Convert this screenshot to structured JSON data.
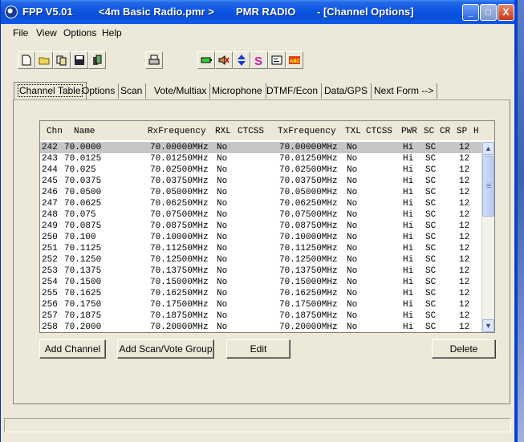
{
  "titlebar": {
    "app": "FPP V5.01",
    "file": "<4m Basic Radio.pmr >",
    "product": "PMR RADIO",
    "view": "- [Channel Options]"
  },
  "menu": [
    "File",
    "View",
    "Options",
    "Help"
  ],
  "toolbar": {
    "icons": [
      "new-file-icon",
      "open-folder-icon",
      "copy-icon",
      "save-icon",
      "radio-device-icon",
      "print-icon",
      "battery-icon",
      "mute-speaker-icon",
      "sort-arrows-icon",
      "s-icon",
      "form-icon",
      "abc-icon"
    ]
  },
  "tabs": [
    "Channel Table",
    "Options",
    "Scan",
    "Vote/Multiax",
    "Microphone",
    "DTMF/Econ",
    "Data/GPS",
    "Next Form -->"
  ],
  "table": {
    "headers": [
      "Chn",
      "Name",
      "RxFrequency",
      "RXL",
      "CTCSS",
      "TxFrequency",
      "TXL",
      "CTCSS",
      "PWR",
      "SC",
      "CR",
      "SP",
      "H"
    ],
    "rows": [
      [
        "242",
        "70.0000",
        "70.00000MHz",
        "No",
        "70.00000MHz",
        "No",
        "Hi",
        "SC",
        "12"
      ],
      [
        "243",
        "70.0125",
        "70.01250MHz",
        "No",
        "70.01250MHz",
        "No",
        "Hi",
        "SC",
        "12"
      ],
      [
        "244",
        "70.025",
        "70.02500MHz",
        "No",
        "70.02500MHz",
        "No",
        "Hi",
        "SC",
        "12"
      ],
      [
        "245",
        "70.0375",
        "70.03750MHz",
        "No",
        "70.03750MHz",
        "No",
        "Hi",
        "SC",
        "12"
      ],
      [
        "246",
        "70.0500",
        "70.05000MHz",
        "No",
        "70.05000MHz",
        "No",
        "Hi",
        "SC",
        "12"
      ],
      [
        "247",
        "70.0625",
        "70.06250MHz",
        "No",
        "70.06250MHz",
        "No",
        "Hi",
        "SC",
        "12"
      ],
      [
        "248",
        "70.075",
        "70.07500MHz",
        "No",
        "70.07500MHz",
        "No",
        "Hi",
        "SC",
        "12"
      ],
      [
        "249",
        "70.0875",
        "70.08750MHz",
        "No",
        "70.08750MHz",
        "No",
        "Hi",
        "SC",
        "12"
      ],
      [
        "250",
        "70.100",
        "70.10000MHz",
        "No",
        "70.10000MHz",
        "No",
        "Hi",
        "SC",
        "12"
      ],
      [
        "251",
        "70.1125",
        "70.11250MHz",
        "No",
        "70.11250MHz",
        "No",
        "Hi",
        "SC",
        "12"
      ],
      [
        "252",
        "70.1250",
        "70.12500MHz",
        "No",
        "70.12500MHz",
        "No",
        "Hi",
        "SC",
        "12"
      ],
      [
        "253",
        "70.1375",
        "70.13750MHz",
        "No",
        "70.13750MHz",
        "No",
        "Hi",
        "SC",
        "12"
      ],
      [
        "254",
        "70.1500",
        "70.15000MHz",
        "No",
        "70.15000MHz",
        "No",
        "Hi",
        "SC",
        "12"
      ],
      [
        "255",
        "70.1625",
        "70.16250MHz",
        "No",
        "70.16250MHz",
        "No",
        "Hi",
        "SC",
        "12"
      ],
      [
        "256",
        "70.1750",
        "70.17500MHz",
        "No",
        "70.17500MHz",
        "No",
        "Hi",
        "SC",
        "12"
      ],
      [
        "257",
        "70.1875",
        "70.18750MHz",
        "No",
        "70.18750MHz",
        "No",
        "Hi",
        "SC",
        "12"
      ],
      [
        "258",
        "70.2000",
        "70.20000MHz",
        "No",
        "70.20000MHz",
        "No",
        "Hi",
        "SC",
        "12"
      ]
    ]
  },
  "buttons": {
    "add_channel": "Add Channel",
    "add_scan_vote": "Add Scan/Vote Group",
    "edit": "Edit",
    "delete": "Delete"
  },
  "window_controls": {
    "minimize": "_",
    "maximize": "□",
    "close": "X"
  },
  "scrollbar": {
    "up": "▲",
    "down": "▼"
  }
}
